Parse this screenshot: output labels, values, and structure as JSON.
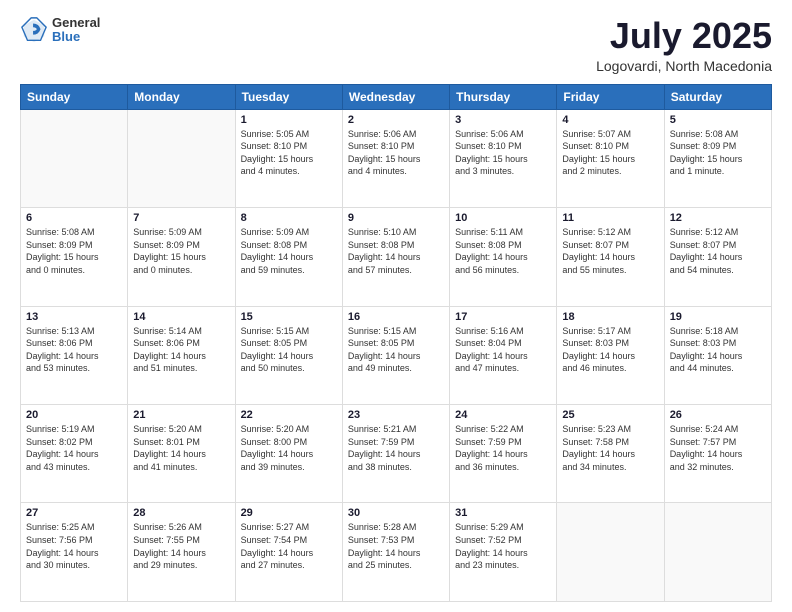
{
  "header": {
    "logo_general": "General",
    "logo_blue": "Blue",
    "month_year": "July 2025",
    "location": "Logovardi, North Macedonia"
  },
  "weekdays": [
    "Sunday",
    "Monday",
    "Tuesday",
    "Wednesday",
    "Thursday",
    "Friday",
    "Saturday"
  ],
  "weeks": [
    [
      {
        "day": "",
        "detail": ""
      },
      {
        "day": "",
        "detail": ""
      },
      {
        "day": "1",
        "detail": "Sunrise: 5:05 AM\nSunset: 8:10 PM\nDaylight: 15 hours\nand 4 minutes."
      },
      {
        "day": "2",
        "detail": "Sunrise: 5:06 AM\nSunset: 8:10 PM\nDaylight: 15 hours\nand 4 minutes."
      },
      {
        "day": "3",
        "detail": "Sunrise: 5:06 AM\nSunset: 8:10 PM\nDaylight: 15 hours\nand 3 minutes."
      },
      {
        "day": "4",
        "detail": "Sunrise: 5:07 AM\nSunset: 8:10 PM\nDaylight: 15 hours\nand 2 minutes."
      },
      {
        "day": "5",
        "detail": "Sunrise: 5:08 AM\nSunset: 8:09 PM\nDaylight: 15 hours\nand 1 minute."
      }
    ],
    [
      {
        "day": "6",
        "detail": "Sunrise: 5:08 AM\nSunset: 8:09 PM\nDaylight: 15 hours\nand 0 minutes."
      },
      {
        "day": "7",
        "detail": "Sunrise: 5:09 AM\nSunset: 8:09 PM\nDaylight: 15 hours\nand 0 minutes."
      },
      {
        "day": "8",
        "detail": "Sunrise: 5:09 AM\nSunset: 8:08 PM\nDaylight: 14 hours\nand 59 minutes."
      },
      {
        "day": "9",
        "detail": "Sunrise: 5:10 AM\nSunset: 8:08 PM\nDaylight: 14 hours\nand 57 minutes."
      },
      {
        "day": "10",
        "detail": "Sunrise: 5:11 AM\nSunset: 8:08 PM\nDaylight: 14 hours\nand 56 minutes."
      },
      {
        "day": "11",
        "detail": "Sunrise: 5:12 AM\nSunset: 8:07 PM\nDaylight: 14 hours\nand 55 minutes."
      },
      {
        "day": "12",
        "detail": "Sunrise: 5:12 AM\nSunset: 8:07 PM\nDaylight: 14 hours\nand 54 minutes."
      }
    ],
    [
      {
        "day": "13",
        "detail": "Sunrise: 5:13 AM\nSunset: 8:06 PM\nDaylight: 14 hours\nand 53 minutes."
      },
      {
        "day": "14",
        "detail": "Sunrise: 5:14 AM\nSunset: 8:06 PM\nDaylight: 14 hours\nand 51 minutes."
      },
      {
        "day": "15",
        "detail": "Sunrise: 5:15 AM\nSunset: 8:05 PM\nDaylight: 14 hours\nand 50 minutes."
      },
      {
        "day": "16",
        "detail": "Sunrise: 5:15 AM\nSunset: 8:05 PM\nDaylight: 14 hours\nand 49 minutes."
      },
      {
        "day": "17",
        "detail": "Sunrise: 5:16 AM\nSunset: 8:04 PM\nDaylight: 14 hours\nand 47 minutes."
      },
      {
        "day": "18",
        "detail": "Sunrise: 5:17 AM\nSunset: 8:03 PM\nDaylight: 14 hours\nand 46 minutes."
      },
      {
        "day": "19",
        "detail": "Sunrise: 5:18 AM\nSunset: 8:03 PM\nDaylight: 14 hours\nand 44 minutes."
      }
    ],
    [
      {
        "day": "20",
        "detail": "Sunrise: 5:19 AM\nSunset: 8:02 PM\nDaylight: 14 hours\nand 43 minutes."
      },
      {
        "day": "21",
        "detail": "Sunrise: 5:20 AM\nSunset: 8:01 PM\nDaylight: 14 hours\nand 41 minutes."
      },
      {
        "day": "22",
        "detail": "Sunrise: 5:20 AM\nSunset: 8:00 PM\nDaylight: 14 hours\nand 39 minutes."
      },
      {
        "day": "23",
        "detail": "Sunrise: 5:21 AM\nSunset: 7:59 PM\nDaylight: 14 hours\nand 38 minutes."
      },
      {
        "day": "24",
        "detail": "Sunrise: 5:22 AM\nSunset: 7:59 PM\nDaylight: 14 hours\nand 36 minutes."
      },
      {
        "day": "25",
        "detail": "Sunrise: 5:23 AM\nSunset: 7:58 PM\nDaylight: 14 hours\nand 34 minutes."
      },
      {
        "day": "26",
        "detail": "Sunrise: 5:24 AM\nSunset: 7:57 PM\nDaylight: 14 hours\nand 32 minutes."
      }
    ],
    [
      {
        "day": "27",
        "detail": "Sunrise: 5:25 AM\nSunset: 7:56 PM\nDaylight: 14 hours\nand 30 minutes."
      },
      {
        "day": "28",
        "detail": "Sunrise: 5:26 AM\nSunset: 7:55 PM\nDaylight: 14 hours\nand 29 minutes."
      },
      {
        "day": "29",
        "detail": "Sunrise: 5:27 AM\nSunset: 7:54 PM\nDaylight: 14 hours\nand 27 minutes."
      },
      {
        "day": "30",
        "detail": "Sunrise: 5:28 AM\nSunset: 7:53 PM\nDaylight: 14 hours\nand 25 minutes."
      },
      {
        "day": "31",
        "detail": "Sunrise: 5:29 AM\nSunset: 7:52 PM\nDaylight: 14 hours\nand 23 minutes."
      },
      {
        "day": "",
        "detail": ""
      },
      {
        "day": "",
        "detail": ""
      }
    ]
  ]
}
